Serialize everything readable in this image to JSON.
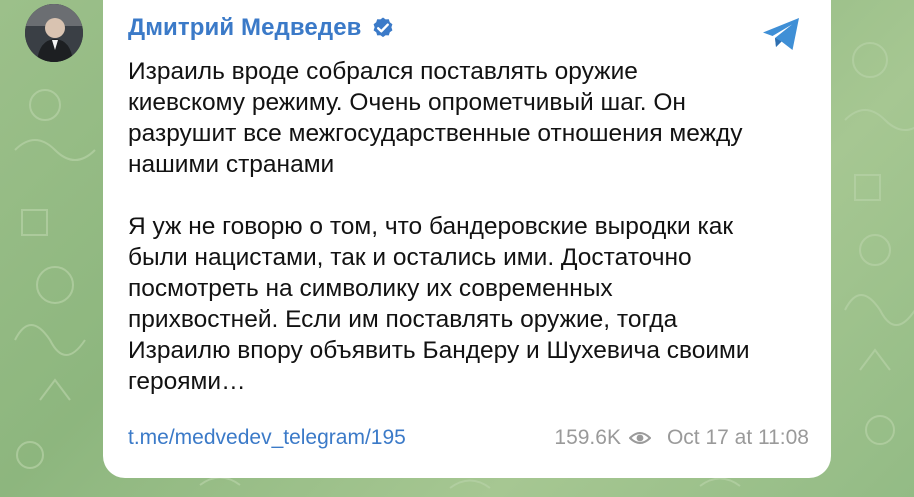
{
  "post": {
    "author": "Дмитрий Медведев",
    "paragraphs": [
      "Израиль вроде собрался поставлять оружие\nкиевскому режиму. Очень опрометчивый шаг. Он\nразрушит все межгосударственные отношения между\nнашими странами",
      "Я уж не говорю о том, что бандеровские выродки как\nбыли нацистами, так и остались ими. Достаточно\nпосмотреть на символику их современных\nприхвостней. Если им поставлять оружие, тогда\nИзраилю впору объявить Бандеру и Шухевича своими\nгероями…"
    ],
    "link": "t.me/medvedev_telegram/195",
    "views": "159.6K",
    "date": "Oct 17 at 11:08"
  },
  "icons": {
    "verified": "verified-badge-icon",
    "telegram": "telegram-logo-icon",
    "views": "eye-icon"
  },
  "colors": {
    "accent": "#3b7ac8",
    "background": "#9cc08a",
    "card": "#ffffff"
  }
}
